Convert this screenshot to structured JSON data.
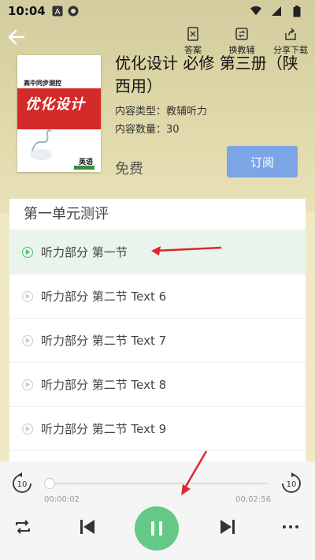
{
  "status_bar": {
    "time": "10:04"
  },
  "top_actions": [
    {
      "label": "答案",
      "icon": "answer-icon"
    },
    {
      "label": "换教辅",
      "icon": "switch-book-icon"
    },
    {
      "label": "分享下载",
      "icon": "share-download-icon"
    }
  ],
  "book": {
    "cover": {
      "series": "高中同步测控",
      "title": "优化设计",
      "subject": "英语"
    },
    "title": "优化设计 必修 第三册（陕西用）",
    "type_label": "内容类型：教辅听力",
    "count_label": "内容数量：30",
    "price": "免费",
    "subscribe_label": "订阅"
  },
  "section": {
    "title": "第一单元测评",
    "items": [
      {
        "label": "听力部分 第一节",
        "active": true
      },
      {
        "label": "听力部分 第二节 Text 6",
        "active": false
      },
      {
        "label": "听力部分 第二节 Text 7",
        "active": false
      },
      {
        "label": "听力部分 第二节 Text 8",
        "active": false
      },
      {
        "label": "听力部分 第二节 Text 9",
        "active": false
      }
    ]
  },
  "player": {
    "rewind_label": "10",
    "forward_label": "10",
    "current_time": "00:00:02",
    "total_time": "00:02:56",
    "progress": 0.01
  },
  "colors": {
    "accent_green": "#64c886",
    "subscribe_blue": "#7ca5e6",
    "arrow_red": "#e0262b"
  }
}
